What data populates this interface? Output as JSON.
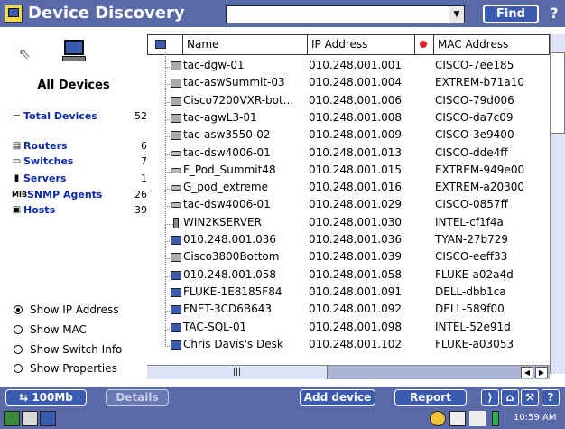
{
  "app": {
    "title": "Device Discovery"
  },
  "search": {
    "value": "",
    "placeholder": ""
  },
  "header": {
    "find_label": "Find",
    "help_glyph": "?"
  },
  "left": {
    "all_devices_label": "All Devices",
    "categories": [
      {
        "label": "Total Devices",
        "count": "52"
      },
      {
        "label": "Routers",
        "count": "6"
      },
      {
        "label": "Switches",
        "count": "7"
      },
      {
        "label": "Servers",
        "count": "1"
      },
      {
        "label": "SNMP Agents",
        "count": "26"
      },
      {
        "label": "Hosts",
        "count": "39"
      }
    ],
    "options": [
      {
        "label": "Show IP Address",
        "selected": true
      },
      {
        "label": "Show MAC",
        "selected": false
      },
      {
        "label": "Show Switch Info",
        "selected": false
      },
      {
        "label": "Show Properties",
        "selected": false
      }
    ]
  },
  "table": {
    "columns": [
      "Name",
      "IP Address",
      "MAC Address"
    ],
    "rows": [
      {
        "icon": "router",
        "name": "tac-dgw-01",
        "ip": "010.248.001.001",
        "mac": "CISCO-7ee185"
      },
      {
        "icon": "router",
        "name": "tac-aswSummit-03",
        "ip": "010.248.001.004",
        "mac": "EXTREM-b71a10"
      },
      {
        "icon": "router",
        "name": "Cisco7200VXR-bot...",
        "ip": "010.248.001.006",
        "mac": "CISCO-79d006"
      },
      {
        "icon": "router",
        "name": "tac-agwL3-01",
        "ip": "010.248.001.008",
        "mac": "CISCO-da7c09"
      },
      {
        "icon": "router",
        "name": "tac-asw3550-02",
        "ip": "010.248.001.009",
        "mac": "CISCO-3e9400"
      },
      {
        "icon": "switch",
        "name": "tac-dsw4006-01",
        "ip": "010.248.001.013",
        "mac": "CISCO-dde4ff"
      },
      {
        "icon": "switch",
        "name": "F_Pod_Summit48",
        "ip": "010.248.001.015",
        "mac": "EXTREM-949e00"
      },
      {
        "icon": "switch",
        "name": "G_pod_extreme",
        "ip": "010.248.001.016",
        "mac": "EXTREM-a20300"
      },
      {
        "icon": "switch",
        "name": "tac-dsw4006-01",
        "ip": "010.248.001.029",
        "mac": "CISCO-0857ff"
      },
      {
        "icon": "server",
        "name": "WIN2KSERVER",
        "ip": "010.248.001.030",
        "mac": "INTEL-cf1f4a"
      },
      {
        "icon": "host",
        "name": "010.248.001.036",
        "ip": "010.248.001.036",
        "mac": "TYAN-27b729"
      },
      {
        "icon": "router",
        "name": "Cisco3800Bottom",
        "ip": "010.248.001.039",
        "mac": "CISCO-eeff33"
      },
      {
        "icon": "host",
        "name": "010.248.001.058",
        "ip": "010.248.001.058",
        "mac": "FLUKE-a02a4d"
      },
      {
        "icon": "host",
        "name": "FLUKE-1E8185F84",
        "ip": "010.248.001.091",
        "mac": "DELL-dbb1ca"
      },
      {
        "icon": "host",
        "name": "FNET-3CD6B643",
        "ip": "010.248.001.092",
        "mac": "DELL-589f00"
      },
      {
        "icon": "host",
        "name": "TAC-SQL-01",
        "ip": "010.248.001.098",
        "mac": "INTEL-52e91d"
      },
      {
        "icon": "host",
        "name": "Chris Davis's Desk",
        "ip": "010.248.001.102",
        "mac": "FLUKE-a03053"
      }
    ]
  },
  "toolbar": {
    "speed_label": "100Mb",
    "details_label": "Details",
    "add_device_label": "Add device",
    "report_label": "Report",
    "help_glyph": "?"
  },
  "status": {
    "time": "10:59 AM"
  },
  "colors": {
    "bar": "#5a6aa8",
    "button": "#3b5bb0",
    "link": "#0b2aa8"
  }
}
